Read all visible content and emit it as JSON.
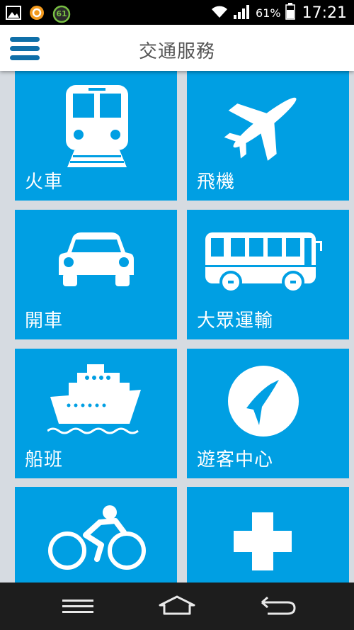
{
  "status_bar": {
    "battery_percent": "61%",
    "time": "17:21",
    "notification_badge": "61"
  },
  "app_bar": {
    "title": "交通服務"
  },
  "tiles": [
    {
      "label": "火車",
      "icon": "train-icon"
    },
    {
      "label": "飛機",
      "icon": "airplane-icon"
    },
    {
      "label": "開車",
      "icon": "car-icon"
    },
    {
      "label": "大眾運輸",
      "icon": "bus-icon"
    },
    {
      "label": "船班",
      "icon": "ship-icon"
    },
    {
      "label": "遊客中心",
      "icon": "visitor-center-icon"
    },
    {
      "label": "",
      "icon": "bicycle-icon"
    },
    {
      "label": "",
      "icon": "medical-cross-icon"
    }
  ],
  "colors": {
    "tile": "#009fe3",
    "menu_icon": "#0f6fa8",
    "background": "#d6dbe1"
  }
}
